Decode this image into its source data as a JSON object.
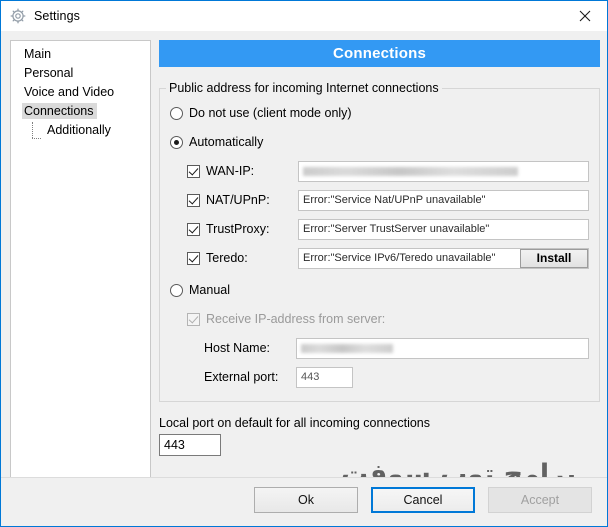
{
  "window": {
    "title": "Settings",
    "icon": "gear-icon",
    "close_label": "✕",
    "accent_color": "#0078d7"
  },
  "sidebar": {
    "items": [
      {
        "label": "Main",
        "selected": false,
        "child": false
      },
      {
        "label": "Personal",
        "selected": false,
        "child": false
      },
      {
        "label": "Voice and Video",
        "selected": false,
        "child": false
      },
      {
        "label": "Connections",
        "selected": true,
        "child": false
      },
      {
        "label": "Additionally",
        "selected": false,
        "child": true
      }
    ]
  },
  "panel": {
    "header_title": "Connections",
    "header_color": "#3399f3"
  },
  "public_address_group": {
    "legend": "Public address for incoming Internet connections",
    "mode_options": [
      {
        "label": "Do not use (client mode only)",
        "selected": false
      },
      {
        "label": "Automatically",
        "selected": true
      },
      {
        "label": "Manual",
        "selected": false
      }
    ],
    "automatic_fields": [
      {
        "label": "WAN-IP:",
        "checked": true,
        "value": "[2001:0:9d38:6abd:2036:f477:4f8b:779c]",
        "redacted": true,
        "has_button": false
      },
      {
        "label": "NAT/UPnP:",
        "checked": true,
        "value": "Error:\"Service Nat/UPnP unavailable\"",
        "redacted": false,
        "has_button": false
      },
      {
        "label": "TrustProxy:",
        "checked": true,
        "value": "Error:\"Server TrustServer unavailable\"",
        "redacted": false,
        "has_button": false
      },
      {
        "label": "Teredo:",
        "checked": true,
        "value": "Error:\"Service IPv6/Teredo unavailable\"",
        "redacted": false,
        "has_button": true,
        "button_label": "Install"
      }
    ],
    "manual_fields": {
      "receive_ip_label": "Receive IP-address from server:",
      "receive_ip_checked": true,
      "receive_ip_disabled": true,
      "host_name_label": "Host Name:",
      "host_name_value": "178.218.136.99",
      "host_name_redacted": true,
      "external_port_label": "External port:",
      "external_port_value": "443"
    }
  },
  "local_port": {
    "label": "Local port on default for all incoming connections",
    "value": "443"
  },
  "watermark": {
    "text": "برامج توب سوفت"
  },
  "footer": {
    "ok_label": "Ok",
    "cancel_label": "Cancel",
    "accept_label": "Accept"
  }
}
